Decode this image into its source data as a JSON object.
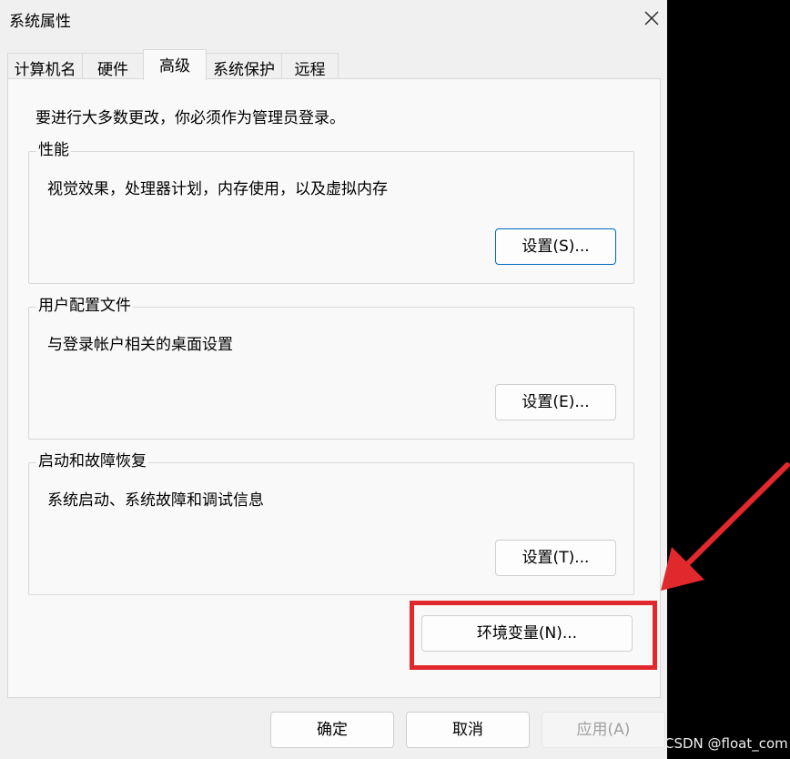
{
  "window": {
    "title": "系统属性"
  },
  "tabs": [
    {
      "label": "计算机名"
    },
    {
      "label": "硬件"
    },
    {
      "label": "高级"
    },
    {
      "label": "系统保护"
    },
    {
      "label": "远程"
    }
  ],
  "notice": "要进行大多数更改，你必须作为管理员登录。",
  "groups": {
    "performance": {
      "title": "性能",
      "description": "视觉效果，处理器计划，内存使用，以及虚拟内存",
      "button": "设置(S)..."
    },
    "user_profiles": {
      "title": "用户配置文件",
      "description": "与登录帐户相关的桌面设置",
      "button": "设置(E)..."
    },
    "startup_recovery": {
      "title": "启动和故障恢复",
      "description": "系统启动、系统故障和调试信息",
      "button": "设置(T)..."
    }
  },
  "env_button": "环境变量(N)...",
  "footer": {
    "ok": "确定",
    "cancel": "取消",
    "apply": "应用(A)"
  },
  "annotation": {
    "color": "#e0282d"
  },
  "watermark": "CSDN @float_com"
}
